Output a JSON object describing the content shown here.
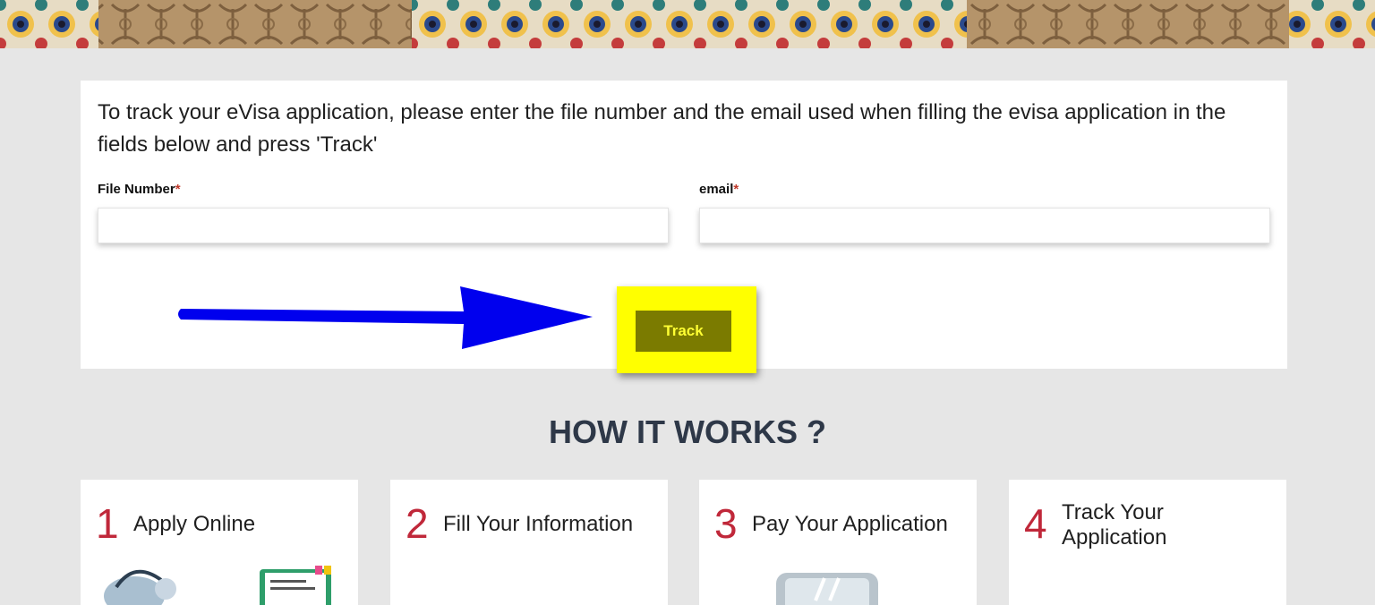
{
  "intro_text": "To track your eVisa application, please enter the file number and the email used when filling the evisa application in the fields below and press 'Track'",
  "form": {
    "file_number": {
      "label": "File Number",
      "required_mark": "*",
      "value": "",
      "placeholder": ""
    },
    "email": {
      "label": "email",
      "required_mark": "*",
      "value": "",
      "placeholder": ""
    },
    "track_label": "Track"
  },
  "how_it_works": {
    "title": "HOW IT WORKS ?",
    "steps": [
      {
        "number": "1",
        "title": "Apply Online"
      },
      {
        "number": "2",
        "title": "Fill Your Information"
      },
      {
        "number": "3",
        "title": "Pay Your Application"
      },
      {
        "number": "4",
        "title": "Track Your Application"
      }
    ]
  },
  "colors": {
    "page_background": "#e6e6e6",
    "card_background": "#ffffff",
    "step_number": "#c0283a",
    "heading": "#2e3848",
    "highlight": "#ffff00",
    "track_button": "#7b7b00",
    "track_text": "#ffff33",
    "annotation_arrow": "#0000ee"
  },
  "icons": {
    "banner": "moroccan-mosaic-banner",
    "annotation": "blue-pointer-arrow"
  }
}
